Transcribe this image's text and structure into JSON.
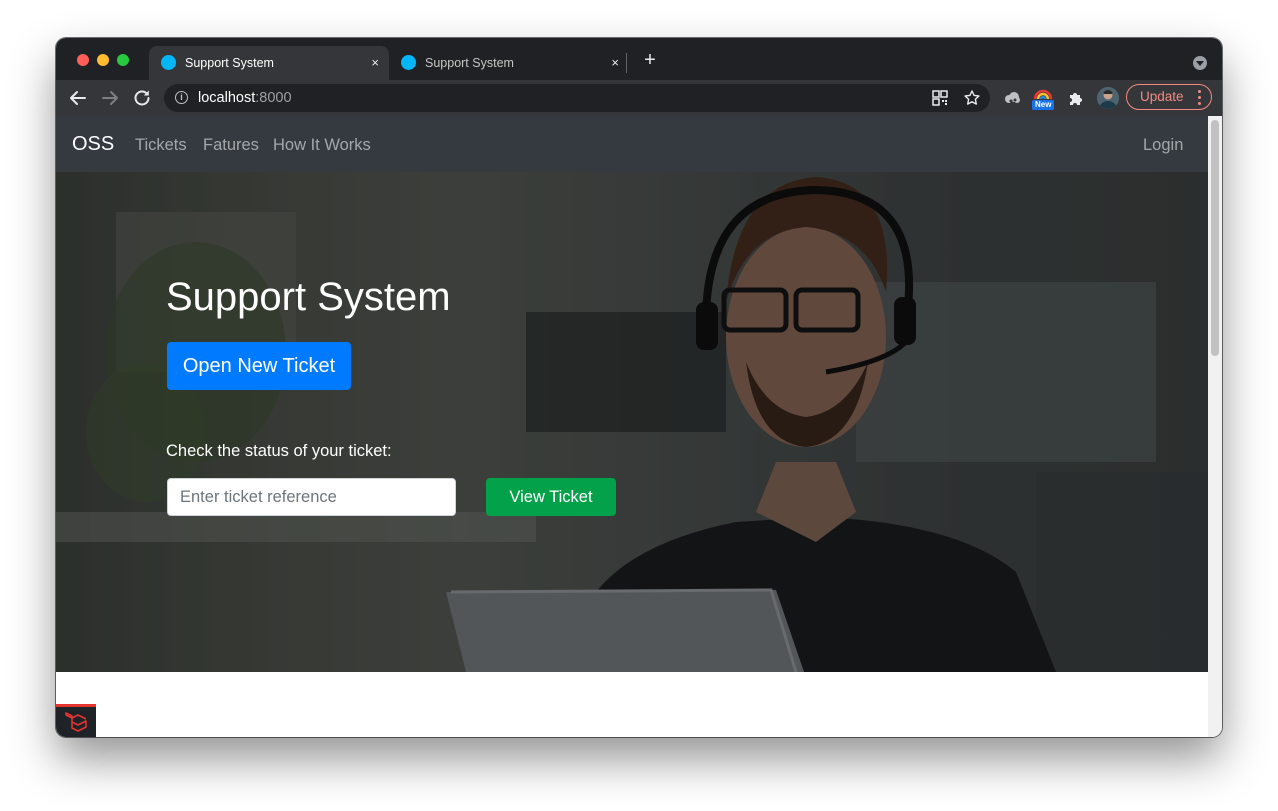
{
  "browser": {
    "tabs": [
      {
        "title": "Support System",
        "active": true
      },
      {
        "title": "Support System",
        "active": false
      }
    ],
    "close_glyph": "×",
    "new_tab_glyph": "+",
    "url_host": "localhost",
    "url_port": ":8000",
    "new_badge": "New",
    "update_label": "Update",
    "icons": [
      "back-icon",
      "forward-icon",
      "reload-icon",
      "info-icon",
      "qr-code-icon",
      "star-icon",
      "extension-icon",
      "puzzle-icon",
      "avatar",
      "menu-icon"
    ],
    "accent_color": "#f28b82"
  },
  "navbar": {
    "brand": "OSS",
    "links": [
      "Tickets",
      "Fatures",
      "How It Works"
    ],
    "login": "Login",
    "bg_color": "#343a40"
  },
  "hero": {
    "title": "Support System",
    "open_ticket_label": "Open New Ticket",
    "status_label": "Check the status of your ticket:",
    "reference_placeholder": "Enter ticket reference",
    "view_ticket_label": "View Ticket",
    "primary_color": "#007bff",
    "success_color": "#03a14a"
  },
  "footer": {
    "badge_icon": "laravel-logo-icon"
  }
}
